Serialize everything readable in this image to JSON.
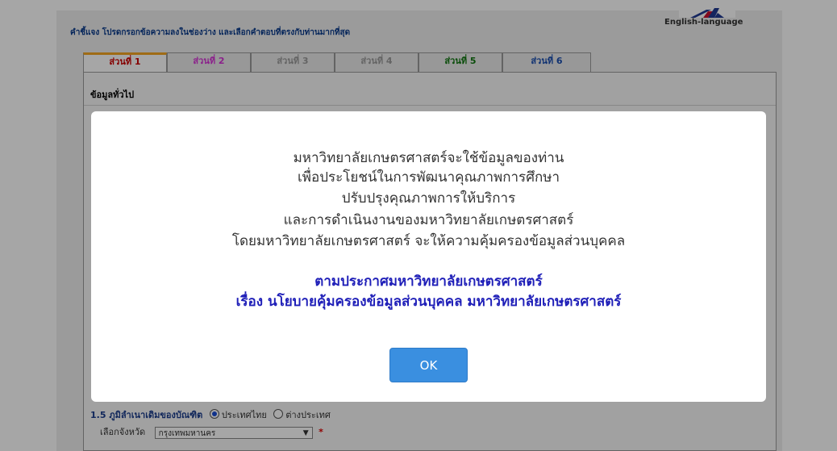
{
  "header": {
    "instructions": "คำชี้แจง โปรดกรอกข้อความลงในช่องว่าง และเลือกคำตอบที่ตรงกับท่านมากที่สุด",
    "language_link": "English-language",
    "flag_icon": "uk-flag-icon"
  },
  "tabs": [
    {
      "label": "ส่วนที่ 1",
      "color": "#cc0000"
    },
    {
      "label": "ส่วนที่ 2",
      "color": "#d633d6"
    },
    {
      "label": "ส่วนที่ 3",
      "color": "#9a9a9a"
    },
    {
      "label": "ส่วนที่ 4",
      "color": "#9a9a9a"
    },
    {
      "label": "ส่วนที่ 5",
      "color": "#117711"
    },
    {
      "label": "ส่วนที่ 6",
      "color": "#1b4fb0"
    }
  ],
  "form": {
    "section_title": "ข้อมูลทั่วไป",
    "q15": {
      "label": "1.5 ภูมิลำเนาเดิมของบัณฑิต",
      "option_thailand": "ประเทศไทย",
      "option_abroad": "ต่างประเทศ",
      "province_label": "เลือกจังหวัด",
      "province_value": "กรุงเทพมหานคร",
      "required_mark": "*"
    }
  },
  "modal": {
    "lines": [
      "มหาวิทยาลัยเกษตรศาสตร์จะใช้ข้อมูลของท่าน",
      "เพื่อประโยชน์ในการพัฒนาคุณภาพการศึกษา",
      "ปรับปรุงคุณภาพการให้บริการ",
      "และการดำเนินงานของมหาวิทยาลัยเกษตรศาสตร์",
      "โดยมหาวิทยาลัยเกษตรศาสตร์ จะให้ความคุ้มครองข้อมูลส่วนบุคคล"
    ],
    "announcement_lines": [
      "ตามประกาศมหาวิทยาลัยเกษตรศาสตร์",
      "เรื่อง นโยบายคุ้มครองข้อมูลส่วนบุคคล มหาวิทยาลัยเกษตรศาสตร์"
    ],
    "ok_label": "OK"
  }
}
